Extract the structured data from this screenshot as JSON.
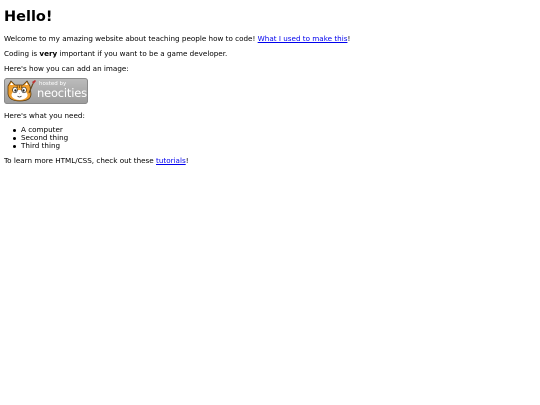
{
  "heading": "Hello!",
  "intro": {
    "text": "Welcome to my amazing website about teaching people how to code! ",
    "link_label": "What I used to make this",
    "suffix": "!"
  },
  "coding": {
    "prefix": "Coding is ",
    "emphasis": "very",
    "suffix": " important if you want to be a game developer."
  },
  "image_intro": "Here's how you can add an image:",
  "badge": {
    "small_text": "hosted by",
    "big_text": "neocities",
    "icon": "neocities-cat-logo"
  },
  "needs_intro": "Here's what you need:",
  "needs": [
    "A computer",
    "Second thing",
    "Third thing"
  ],
  "learn": {
    "prefix": "To learn more HTML/CSS, check out these ",
    "link_label": "tutorials",
    "suffix": "!"
  },
  "colors": {
    "link": "#0000ee",
    "badge_bg": "#a8a8a8",
    "cat_orange": "#f0a030"
  }
}
